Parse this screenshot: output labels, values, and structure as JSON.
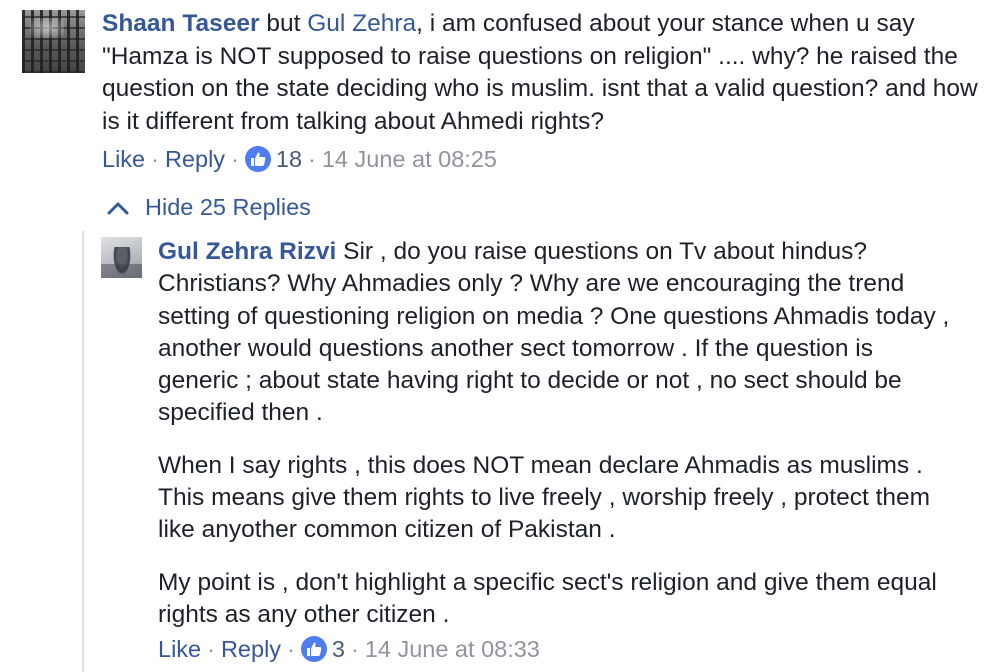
{
  "comments": [
    {
      "author": "Shaan Taseer",
      "text_before_mention": " but ",
      "mention": "Gul Zehra",
      "text_after_mention": ", i am confused about your stance when u say \"Hamza is NOT supposed to raise questions on religion\" .... why? he raised the question on the state deciding who is muslim. isnt that a valid question? and how is it different from talking about Ahmedi rights?",
      "like_label": "Like",
      "reply_label": "Reply",
      "like_count": "18",
      "timestamp": "14 June at 08:25"
    }
  ],
  "replies_toggle": {
    "label": "Hide 25 Replies",
    "icon": "chevron-up-icon"
  },
  "replies": [
    {
      "author": "Gul Zehra Rizvi",
      "paragraphs": [
        " Sir , do you raise questions on Tv about hindus? Christians? Why Ahmadies only ? Why are we encouraging the trend setting of questioning religion on media ? One questions Ahmadis today , another would questions another sect tomorrow . If the question is generic ; about state having right to decide or not , no sect should be specified then .",
        "When I say rights , this does NOT mean declare Ahmadis as muslims . This means give them rights to live freely , worship freely , protect them like anyother common citizen of Pakistan .",
        "My point is , don't highlight a specific sect's religion and give them equal rights as any other citizen ."
      ],
      "like_label": "Like",
      "reply_label": "Reply",
      "like_count": "3",
      "timestamp": "14 June at 08:33"
    }
  ],
  "separator": "·",
  "colors": {
    "link": "#365899",
    "meta": "#90949c",
    "like_badge": "#4f7df0",
    "text": "#1d2129"
  }
}
